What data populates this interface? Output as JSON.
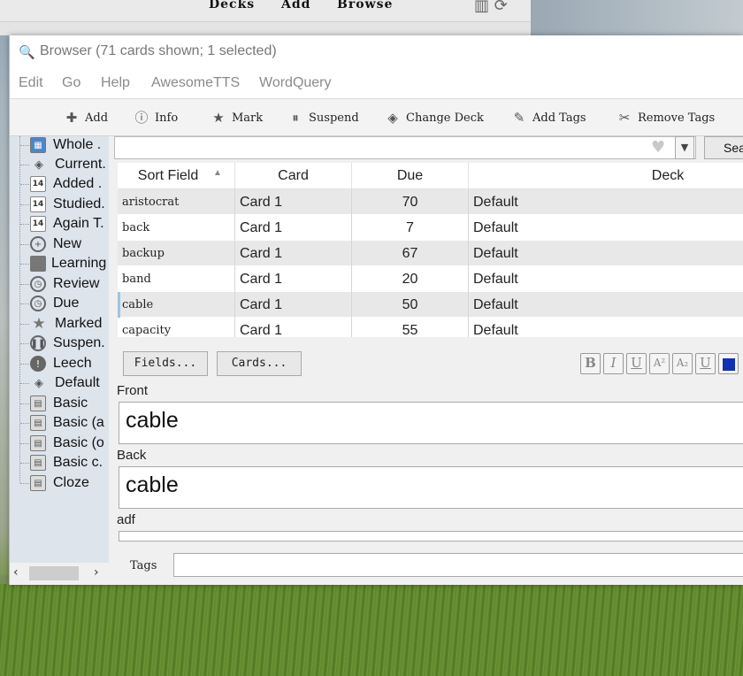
{
  "main_window": {
    "nav": [
      "Decks",
      "Add",
      "Browse"
    ]
  },
  "browser": {
    "title": "Browser (71 cards shown; 1 selected)",
    "menu": [
      "Edit",
      "Go",
      "Help",
      "AwesomeTTS",
      "WordQuery"
    ],
    "toolbar": [
      {
        "label": "Add",
        "icon": "add-icon"
      },
      {
        "label": "Info",
        "icon": "info-icon"
      },
      {
        "label": "Mark",
        "icon": "star-icon"
      },
      {
        "label": "Suspend",
        "icon": "pause-icon"
      },
      {
        "label": "Change Deck",
        "icon": "deck-icon"
      },
      {
        "label": "Add Tags",
        "icon": "add-tag-icon"
      },
      {
        "label": "Remove Tags",
        "icon": "remove-tag-icon"
      }
    ],
    "sidebar": [
      {
        "label": "Whole .",
        "icon": "collection-icon"
      },
      {
        "label": "Current.",
        "icon": "deck-icon"
      },
      {
        "label": "Added .",
        "icon": "calendar-icon"
      },
      {
        "label": "Studied.",
        "icon": "calendar-icon"
      },
      {
        "label": "Again T.",
        "icon": "calendar-icon"
      },
      {
        "label": "New",
        "icon": "plus-circle-icon"
      },
      {
        "label": "Learning",
        "icon": "book-icon"
      },
      {
        "label": "Review",
        "icon": "clock-icon"
      },
      {
        "label": "Due",
        "icon": "clock-icon"
      },
      {
        "label": "Marked",
        "icon": "star-icon"
      },
      {
        "label": "Suspen.",
        "icon": "pause-icon"
      },
      {
        "label": "Leech",
        "icon": "exclamation-icon"
      },
      {
        "label": "Default",
        "icon": "deck-icon"
      },
      {
        "label": "Basic",
        "icon": "note-type-icon"
      },
      {
        "label": "Basic (a",
        "icon": "note-type-icon"
      },
      {
        "label": "Basic (o",
        "icon": "note-type-icon"
      },
      {
        "label": "Basic c.",
        "icon": "note-type-icon"
      },
      {
        "label": "Cloze",
        "icon": "note-type-icon"
      }
    ],
    "search": {
      "button": "Search",
      "value": ""
    },
    "table": {
      "columns": [
        "Sort Field",
        "Card",
        "Due",
        "Deck"
      ],
      "rows": [
        {
          "sort_field": "aristocrat",
          "card": "Card 1",
          "due": "70",
          "deck": "Default"
        },
        {
          "sort_field": "back",
          "card": "Card 1",
          "due": "7",
          "deck": "Default"
        },
        {
          "sort_field": "backup",
          "card": "Card 1",
          "due": "67",
          "deck": "Default"
        },
        {
          "sort_field": "band",
          "card": "Card 1",
          "due": "20",
          "deck": "Default"
        },
        {
          "sort_field": "cable",
          "card": "Card 1",
          "due": "50",
          "deck": "Default",
          "selected": true
        },
        {
          "sort_field": "capacity",
          "card": "Card 1",
          "due": "55",
          "deck": "Default"
        }
      ]
    },
    "editor": {
      "fields_button": "Fields...",
      "cards_button": "Cards...",
      "format_buttons": [
        "B",
        "I",
        "U",
        "A²",
        "A₂",
        "U"
      ],
      "fields": [
        {
          "label": "Front",
          "value": "cable"
        },
        {
          "label": "Back",
          "value": "cable"
        },
        {
          "label": "adf",
          "value": ""
        }
      ],
      "tags_label": "Tags",
      "tags_value": ""
    }
  }
}
